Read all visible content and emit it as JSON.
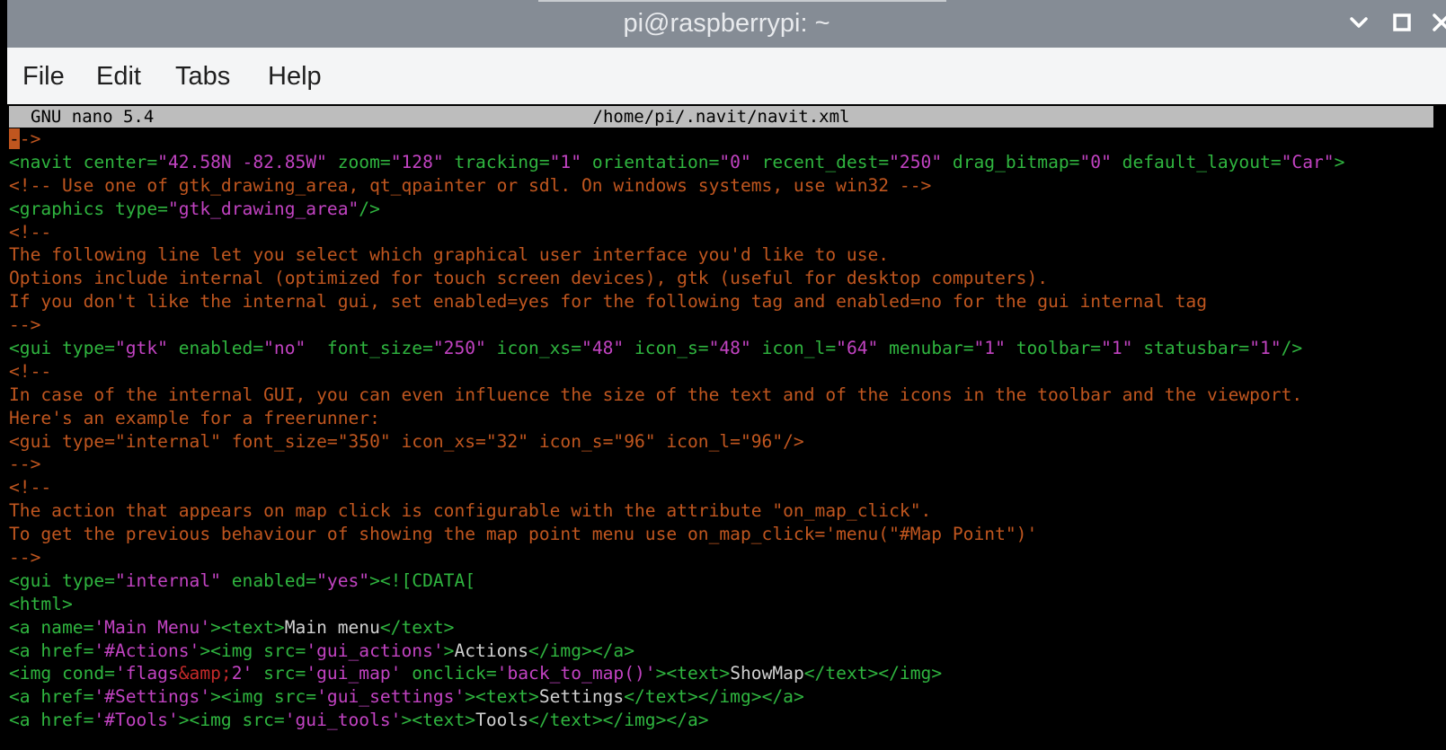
{
  "window": {
    "title": "pi@raspberrypi: ~"
  },
  "menu": {
    "file": "File",
    "edit": "Edit",
    "tabs": "Tabs",
    "help": "Help"
  },
  "nano": {
    "version": "GNU nano 5.4",
    "filename": "/home/pi/.navit/navit.xml"
  },
  "colors": {
    "comment": "#c0561f",
    "tag": "#2fb53f",
    "string": "#c243c2",
    "entity": "#c42a2a",
    "text": "#d0d0d0",
    "header_bg": "#bdbdbd"
  },
  "editor": {
    "lines": [
      [
        {
          "c": "cursor",
          "t": "-"
        },
        {
          "c": "c",
          "t": "->"
        }
      ],
      [
        {
          "c": "t",
          "t": "<navit center="
        },
        {
          "c": "s",
          "t": "\"42.58N -82.85W\""
        },
        {
          "c": "t",
          "t": " zoom="
        },
        {
          "c": "s",
          "t": "\"128\""
        },
        {
          "c": "t",
          "t": " tracking="
        },
        {
          "c": "s",
          "t": "\"1\""
        },
        {
          "c": "t",
          "t": " orientation="
        },
        {
          "c": "s",
          "t": "\"0\""
        },
        {
          "c": "t",
          "t": " recent_dest="
        },
        {
          "c": "s",
          "t": "\"250\""
        },
        {
          "c": "t",
          "t": " drag_bitmap="
        },
        {
          "c": "s",
          "t": "\"0\""
        },
        {
          "c": "t",
          "t": " default_layout="
        },
        {
          "c": "s",
          "t": "\"Car\""
        },
        {
          "c": "t",
          "t": ">"
        }
      ],
      [
        {
          "c": "c",
          "t": "<!-- Use one of gtk_drawing_area, qt_qpainter or sdl. On windows systems, use win32 -->"
        }
      ],
      [
        {
          "c": "t",
          "t": "<graphics type="
        },
        {
          "c": "s",
          "t": "\"gtk_drawing_area\""
        },
        {
          "c": "t",
          "t": "/>"
        }
      ],
      [
        {
          "c": "c",
          "t": "<!--"
        }
      ],
      [
        {
          "c": "c",
          "t": "The following line let you select which graphical user interface you'd like to use."
        }
      ],
      [
        {
          "c": "c",
          "t": "Options include internal (optimized for touch screen devices), gtk (useful for desktop computers)."
        }
      ],
      [
        {
          "c": "c",
          "t": "If you don't like the internal gui, set enabled=yes for the following tag and enabled=no for the gui internal tag"
        }
      ],
      [
        {
          "c": "c",
          "t": "-->"
        }
      ],
      [
        {
          "c": "t",
          "t": "<gui type="
        },
        {
          "c": "s",
          "t": "\"gtk\""
        },
        {
          "c": "t",
          "t": " enabled="
        },
        {
          "c": "s",
          "t": "\"no\""
        },
        {
          "c": "t",
          "t": "  font_size="
        },
        {
          "c": "s",
          "t": "\"250\""
        },
        {
          "c": "t",
          "t": " icon_xs="
        },
        {
          "c": "s",
          "t": "\"48\""
        },
        {
          "c": "t",
          "t": " icon_s="
        },
        {
          "c": "s",
          "t": "\"48\""
        },
        {
          "c": "t",
          "t": " icon_l="
        },
        {
          "c": "s",
          "t": "\"64\""
        },
        {
          "c": "t",
          "t": " menubar="
        },
        {
          "c": "s",
          "t": "\"1\""
        },
        {
          "c": "t",
          "t": " toolbar="
        },
        {
          "c": "s",
          "t": "\"1\""
        },
        {
          "c": "t",
          "t": " statusbar="
        },
        {
          "c": "s",
          "t": "\"1\""
        },
        {
          "c": "t",
          "t": "/>"
        }
      ],
      [
        {
          "c": "c",
          "t": "<!--"
        }
      ],
      [
        {
          "c": "c",
          "t": "In case of the internal GUI, you can even influence the size of the text and of the icons in the toolbar and the viewport."
        }
      ],
      [
        {
          "c": "c",
          "t": "Here's an example for a freerunner:"
        }
      ],
      [
        {
          "c": "c",
          "t": "<gui type=\"internal\" font_size=\"350\" icon_xs=\"32\" icon_s=\"96\" icon_l=\"96\"/>"
        }
      ],
      [
        {
          "c": "c",
          "t": "-->"
        }
      ],
      [
        {
          "c": "c",
          "t": "<!--"
        }
      ],
      [
        {
          "c": "c",
          "t": "The action that appears on map click is configurable with the attribute \"on_map_click\"."
        }
      ],
      [
        {
          "c": "c",
          "t": "To get the previous behaviour of showing the map point menu use on_map_click='menu(\"#Map Point\")'"
        }
      ],
      [
        {
          "c": "c",
          "t": "-->"
        }
      ],
      [
        {
          "c": "t",
          "t": "<gui type="
        },
        {
          "c": "s",
          "t": "\"internal\""
        },
        {
          "c": "t",
          "t": " enabled="
        },
        {
          "c": "s",
          "t": "\"yes\""
        },
        {
          "c": "t",
          "t": "><![CDATA["
        }
      ],
      [
        {
          "c": "t",
          "t": "<html>"
        }
      ],
      [
        {
          "c": "t",
          "t": "<a name="
        },
        {
          "c": "s",
          "t": "'Main Menu'"
        },
        {
          "c": "t",
          "t": "><text>"
        },
        {
          "c": "w",
          "t": "Main menu"
        },
        {
          "c": "t",
          "t": "</text>"
        }
      ],
      [
        {
          "c": "t",
          "t": "<a href="
        },
        {
          "c": "s",
          "t": "'#Actions'"
        },
        {
          "c": "t",
          "t": "><img src="
        },
        {
          "c": "s",
          "t": "'gui_actions'"
        },
        {
          "c": "t",
          "t": ">"
        },
        {
          "c": "w",
          "t": "Actions"
        },
        {
          "c": "t",
          "t": "</img></a>"
        }
      ],
      [
        {
          "c": "t",
          "t": "<img cond="
        },
        {
          "c": "s",
          "t": "'flags"
        },
        {
          "c": "e",
          "t": "&amp;"
        },
        {
          "c": "s",
          "t": "2'"
        },
        {
          "c": "t",
          "t": " src="
        },
        {
          "c": "s",
          "t": "'gui_map'"
        },
        {
          "c": "t",
          "t": " onclick="
        },
        {
          "c": "s",
          "t": "'back_to_map()'"
        },
        {
          "c": "t",
          "t": "><text>"
        },
        {
          "c": "w",
          "t": "ShowMap"
        },
        {
          "c": "t",
          "t": "</text></img>"
        }
      ],
      [
        {
          "c": "t",
          "t": "<a href="
        },
        {
          "c": "s",
          "t": "'#Settings'"
        },
        {
          "c": "t",
          "t": "><img src="
        },
        {
          "c": "s",
          "t": "'gui_settings'"
        },
        {
          "c": "t",
          "t": "><text>"
        },
        {
          "c": "w",
          "t": "Settings"
        },
        {
          "c": "t",
          "t": "</text></img></a>"
        }
      ],
      [
        {
          "c": "t",
          "t": "<a href="
        },
        {
          "c": "s",
          "t": "'#Tools'"
        },
        {
          "c": "t",
          "t": "><img src="
        },
        {
          "c": "s",
          "t": "'gui_tools'"
        },
        {
          "c": "t",
          "t": "><text>"
        },
        {
          "c": "w",
          "t": "Tools"
        },
        {
          "c": "t",
          "t": "</text></img></a>"
        }
      ]
    ]
  }
}
